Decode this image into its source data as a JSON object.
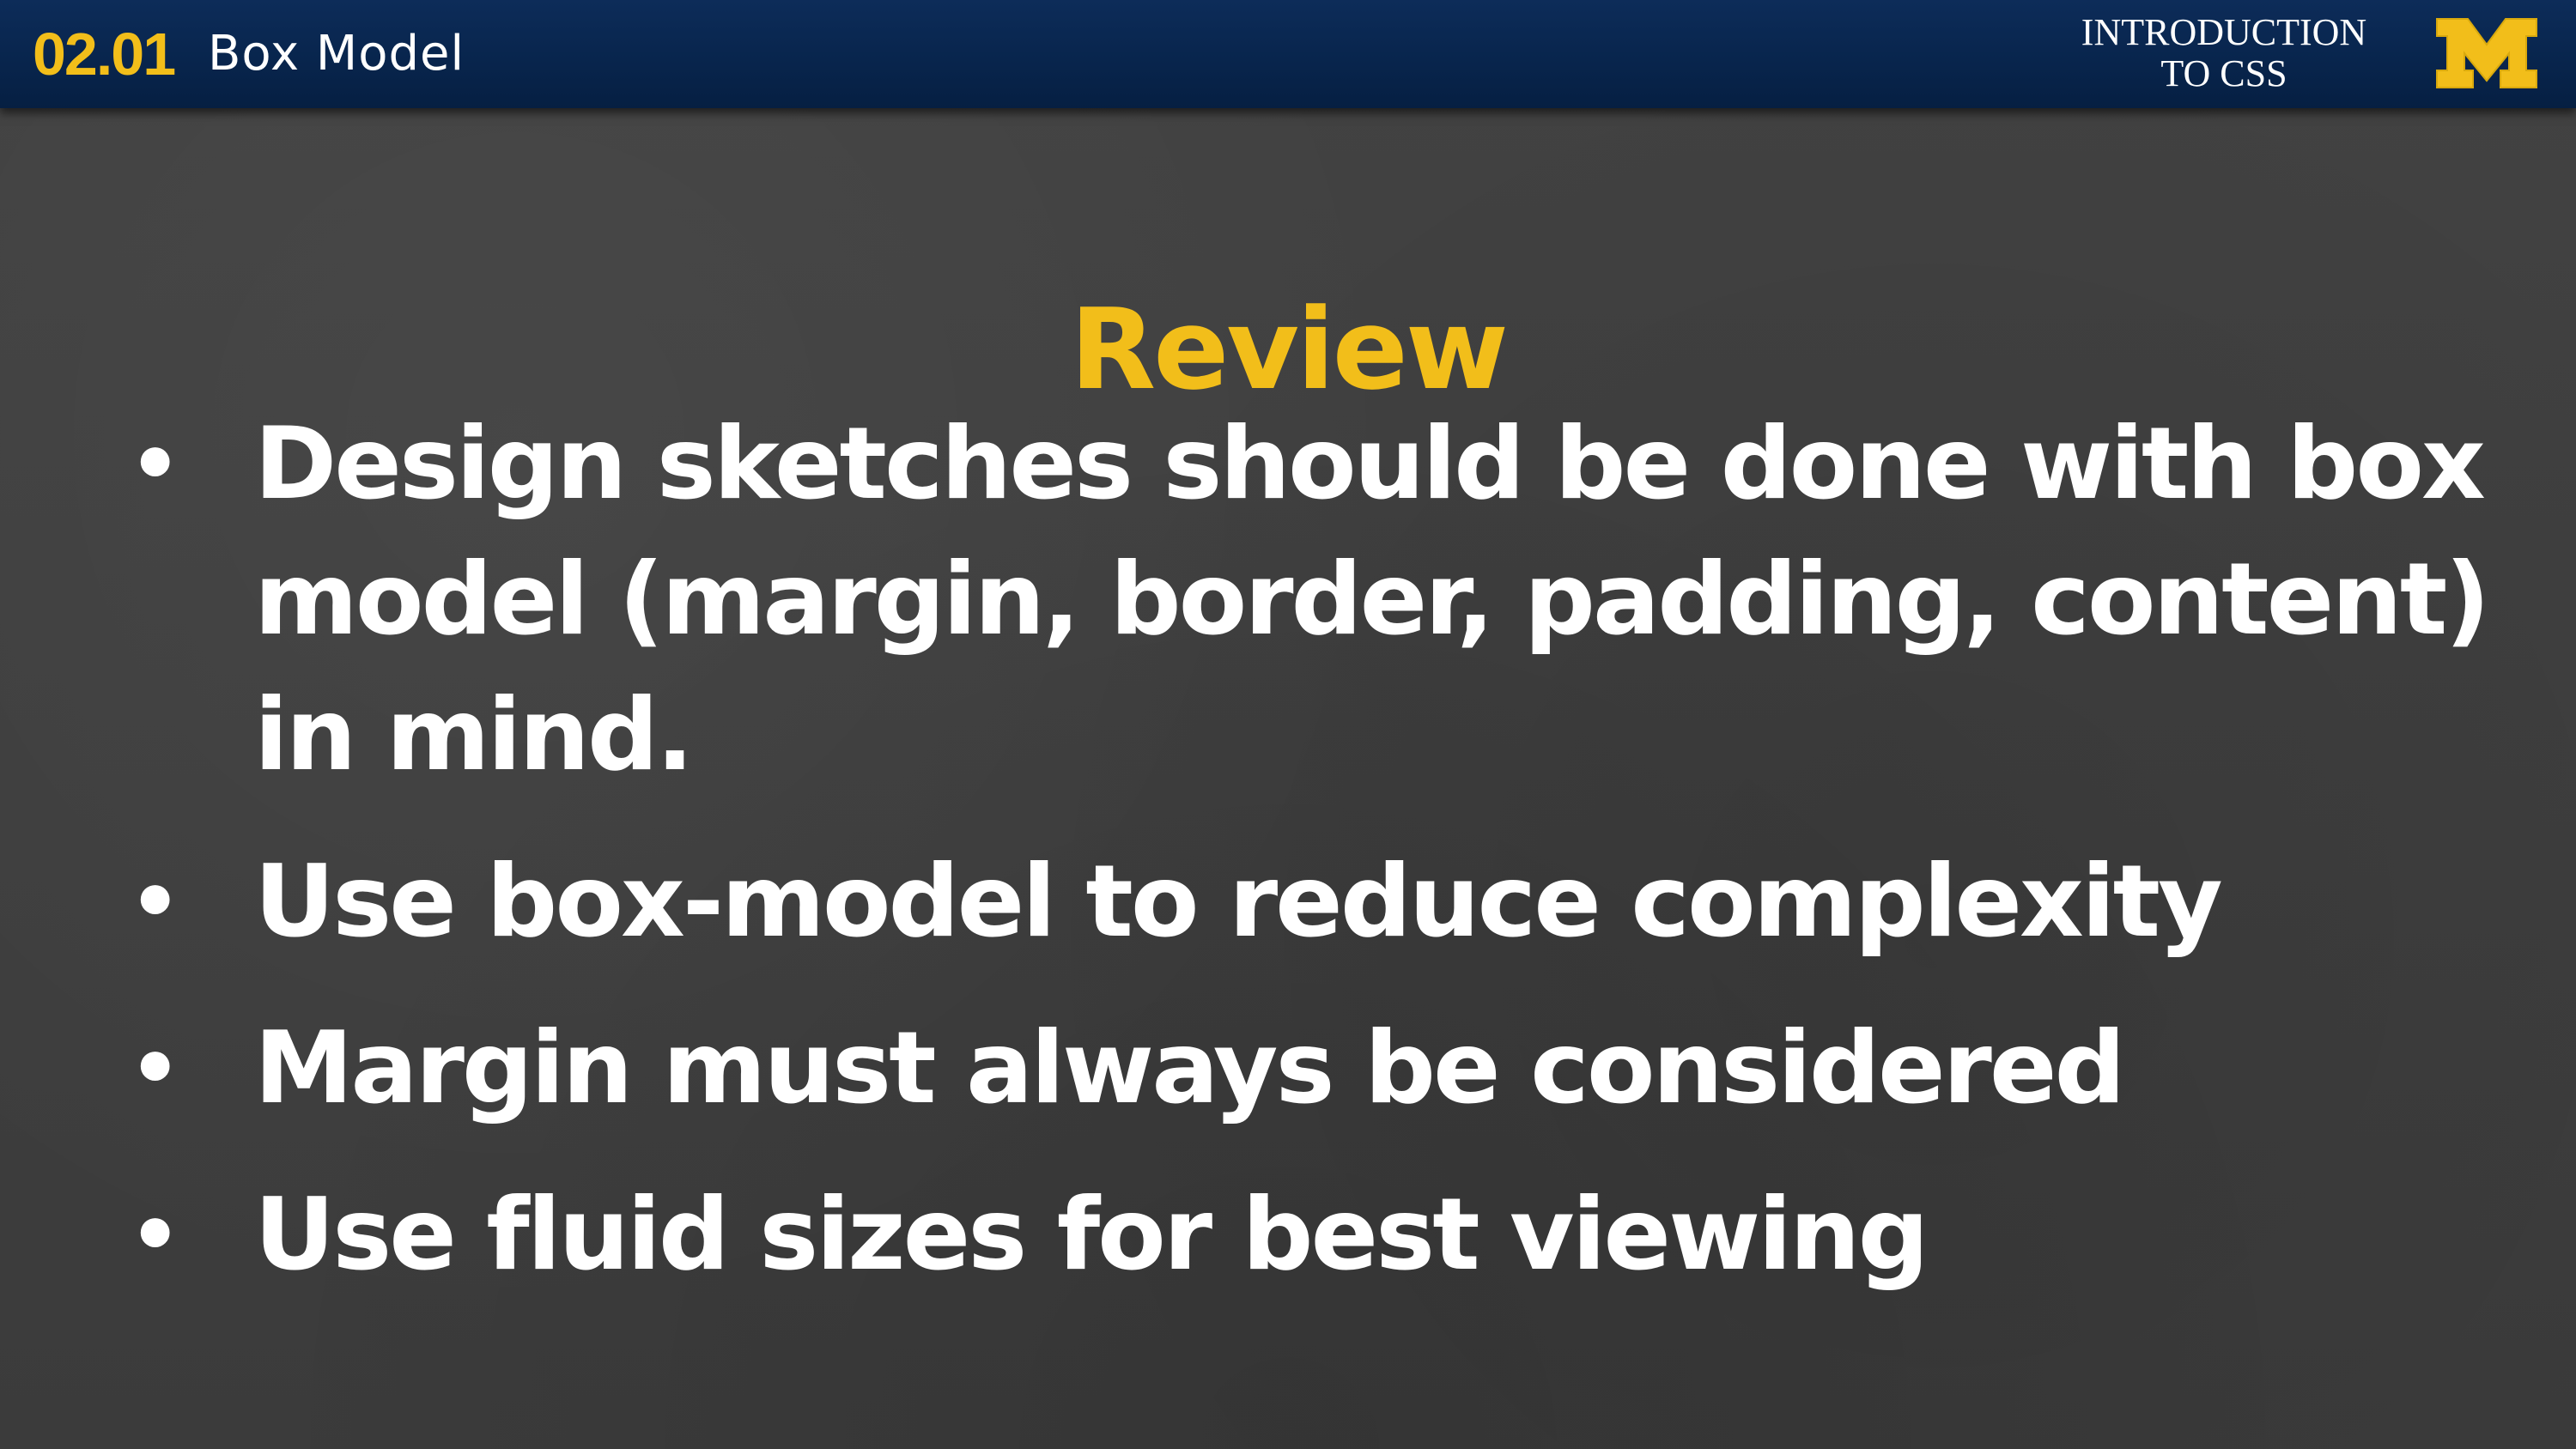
{
  "header": {
    "section_number": "02.01",
    "section_title": "Box Model",
    "course_title_line1": "INTRODUCTION",
    "course_title_line2": "TO CSS",
    "logo_icon": "university-block-m-logo"
  },
  "slide": {
    "title": "Review",
    "bullets": [
      "Design sketches should be done with box model (margin, border, padding, content) in mind.",
      "Use box-model to reduce complexity",
      "Margin must always be considered",
      "Use fluid sizes for best viewing"
    ]
  },
  "colors": {
    "header_bg": "#08254d",
    "accent_yellow": "#f2be1a",
    "slide_bg": "#3f3f3f",
    "text": "#ffffff"
  }
}
